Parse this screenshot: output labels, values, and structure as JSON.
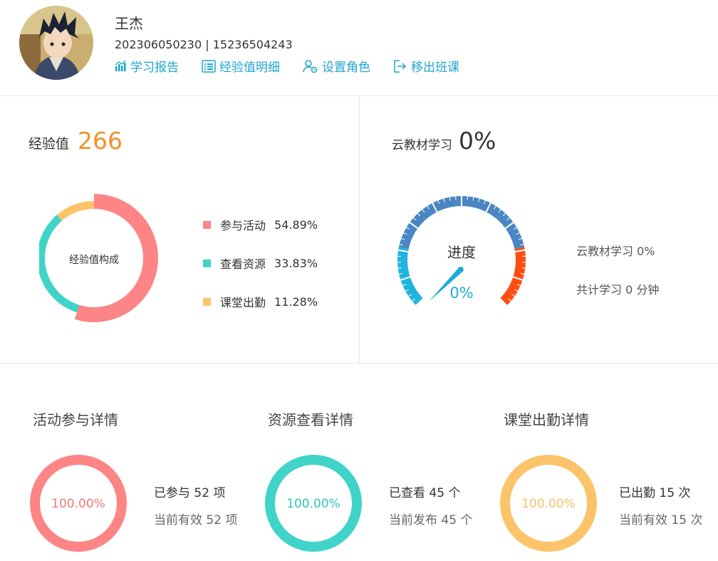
{
  "user": {
    "name": "王杰",
    "ids": "202306050230 | 15236504243"
  },
  "actions": [
    {
      "label": "学习报告",
      "icon": "bar-chart-icon"
    },
    {
      "label": "经验值明细",
      "icon": "list-icon"
    },
    {
      "label": "设置角色",
      "icon": "user-settings-icon"
    },
    {
      "label": "移出班课",
      "icon": "logout-icon"
    }
  ],
  "experience": {
    "label": "经验值",
    "value": "266",
    "donut_center": "经验值构成"
  },
  "chart_data": {
    "type": "pie",
    "categories": [
      "参与活动",
      "查看资源",
      "课堂出勤"
    ],
    "values": [
      54.89,
      33.83,
      11.28
    ],
    "labels": [
      "54.89%",
      "33.83%",
      "11.28%"
    ],
    "colors": [
      "#fd8585",
      "#40d4c8",
      "#fcc46a"
    ],
    "title": "经验值构成"
  },
  "cloud": {
    "label": "云教材学习",
    "value": "0%",
    "gauge_title": "进度",
    "gauge_value": "0%",
    "progress": 0,
    "study_text": "云教材学习 0%",
    "time_text": "共计学习 0 分钟"
  },
  "details": [
    {
      "title": "活动参与详情",
      "percent": "100.00%",
      "line1": "已参与 52 项",
      "line2": "当前有效 52 项",
      "color": "#fd8585",
      "pct_color": "#f07a7a"
    },
    {
      "title": "资源查看详情",
      "percent": "100.00%",
      "line1": "已查看 45 个",
      "line2": "当前发布 45 个",
      "color": "#40d4c8",
      "pct_color": "#34c3bc"
    },
    {
      "title": "课堂出勤详情",
      "percent": "100.00%",
      "line1": "已出勤 15 次",
      "line2": "当前有效 15 次",
      "color": "#fcc46a",
      "pct_color": "#f8bf66"
    }
  ]
}
